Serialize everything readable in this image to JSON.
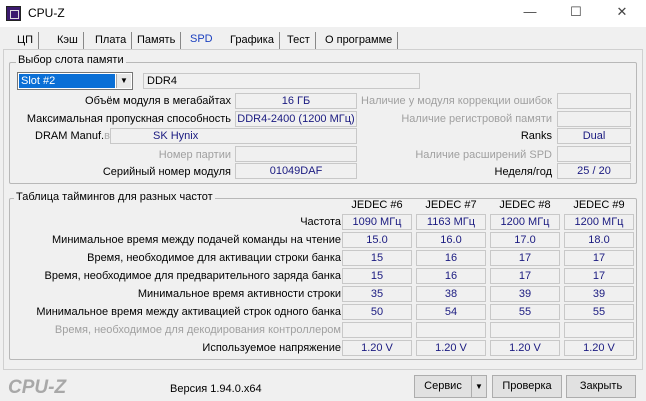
{
  "window": {
    "title": "CPU-Z",
    "minimize": "—",
    "maximize": "☐",
    "close": "✕"
  },
  "tabs": [
    "ЦП",
    "Кэш",
    "Плата",
    "Память",
    "SPD",
    "Графика",
    "Тест",
    "О программе"
  ],
  "slot": {
    "group_label": "Выбор слота памяти",
    "selected": "Slot #2",
    "type": "DDR4",
    "module_size_label": "Объём модуля в мегабайтах",
    "module_size": "16 ГБ",
    "max_bandwidth_label": "Максимальная пропускная способность",
    "max_bandwidth": "DDR4-2400 (1200 МГц)",
    "manuf_label": "DRAM Manuf.",
    "manuf_suffix": "вс",
    "manuf": "SK Hynix",
    "part_label": "Номер партии",
    "part": "",
    "serial_label": "Серийный номер модуля",
    "serial": "01049DAF",
    "ecc_label": "Наличие у модуля коррекции ошибок",
    "ecc": "",
    "registered_label": "Наличие регистровой памяти",
    "registered": "",
    "ranks_label": "Ranks",
    "ranks": "Dual",
    "spd_ext_label": "Наличие расширений SPD",
    "spd_ext": "",
    "week_year_label": "Неделя/год",
    "week_year": "25 / 20"
  },
  "timings": {
    "group_label": "Таблица таймингов для разных частот",
    "columns": [
      "JEDEC #6",
      "JEDEC #7",
      "JEDEC #8",
      "JEDEC #9"
    ],
    "rows": [
      {
        "label": "Частота",
        "values": [
          "1090 МГц",
          "1163 МГц",
          "1200 МГц",
          "1200 МГц"
        ]
      },
      {
        "label": "Минимальное время между подачей команды на чтение",
        "values": [
          "15.0",
          "16.0",
          "17.0",
          "18.0"
        ]
      },
      {
        "label": "Время, необходимое для активации строки банка",
        "values": [
          "15",
          "16",
          "17",
          "17"
        ]
      },
      {
        "label": "Время, необходимое для предварительного заряда банка",
        "values": [
          "15",
          "16",
          "17",
          "17"
        ]
      },
      {
        "label": "Минимальное время активности строки",
        "values": [
          "35",
          "38",
          "39",
          "39"
        ]
      },
      {
        "label": "Минимальное время между активацией строк одного банка",
        "values": [
          "50",
          "54",
          "55",
          "55"
        ]
      },
      {
        "label": "Время, необходимое для декодирования контроллером",
        "values": [
          "",
          "",
          "",
          ""
        ],
        "disabled": true
      },
      {
        "label": "Используемое напряжение",
        "values": [
          "1.20 V",
          "1.20 V",
          "1.20 V",
          "1.20 V"
        ]
      }
    ]
  },
  "footer": {
    "logo": "CPU-Z",
    "version": "Версия 1.94.0.x64",
    "tools": "Сервис",
    "validate": "Проверка",
    "close": "Закрыть"
  }
}
